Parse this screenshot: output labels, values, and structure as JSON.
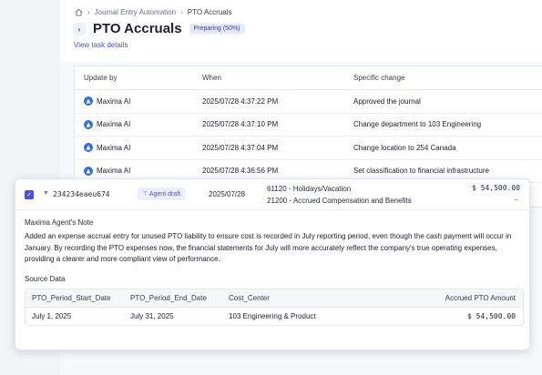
{
  "breadcrumb": [
    "Journal Entry Automation",
    "PTO Accruals"
  ],
  "header": {
    "title": "PTO Accruals",
    "status": "Preparing (50%)",
    "view_link": "View task details"
  },
  "history": {
    "columns": [
      "Update by",
      "When",
      "Specific change"
    ],
    "rows": [
      {
        "by": "Maxima AI",
        "when": "2025/07/28 4:37:22 PM",
        "change": "Approved the journal"
      },
      {
        "by": "Maxima AI",
        "when": "2025/07/28 4:37:10 PM",
        "change": "Change department to 103 Engineering"
      },
      {
        "by": "Maxima AI",
        "when": "2025/07/28 4:37:04 PM",
        "change": "Change location to 254 Canada"
      },
      {
        "by": "Maxima AI",
        "when": "2025/07/28 4:36:56 PM",
        "change": "Set classification to financial infrastructure"
      }
    ]
  },
  "entry": {
    "id": "234234eaeu674",
    "badge": "Agent draft",
    "date": "2025/07/28",
    "account_debit": "61120 - Holidays/Vacation",
    "account_credit": "21200 - Accrued Compensation and Benefits",
    "amount_debit": "$ 54,500.00",
    "amount_credit": "–"
  },
  "note": {
    "title": "Maxima Agent's Note",
    "body": "Added an expense accrual entry for unused PTO liability to ensure cost is recorded in July reporting period, even though the cash payment will occur in January. By recording the PTO expenses now, the financial statements for July will more accurately reflect the company's true operating expenses, providing a clearer and more compliant view of performance."
  },
  "source": {
    "title": "Source Data",
    "columns": [
      "PTO_Period_Start_Date",
      "PTO_Period_End_Date",
      "Cost_Center",
      "Accrued PTO Amount"
    ],
    "rows": [
      [
        "July 1, 2025",
        "July 31, 2025",
        "103 Engineering & Product",
        "$ 54,500.00"
      ]
    ]
  },
  "colors": {
    "accent": "#4a4fd6",
    "ai_icon": "#2f6fe0"
  }
}
